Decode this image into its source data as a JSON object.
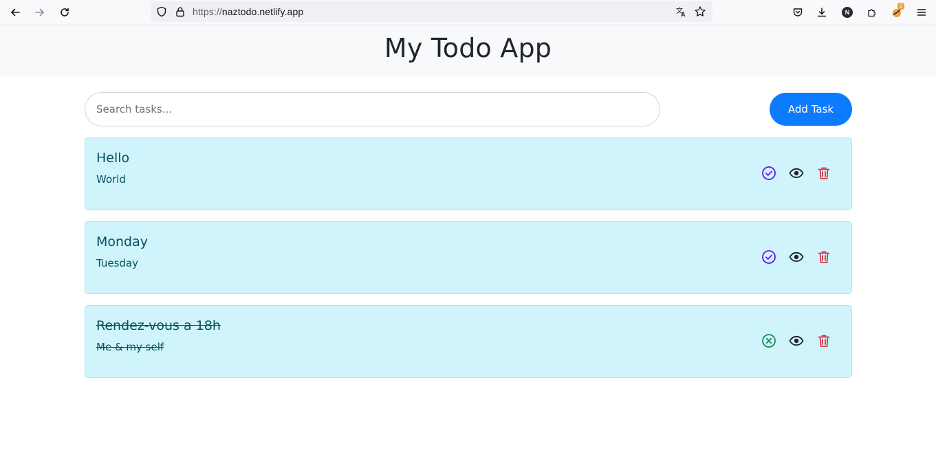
{
  "browser": {
    "url_scheme": "https://",
    "url_host": "naztodo.netlify.app",
    "profile_initial": "N",
    "notification_count": "2"
  },
  "app": {
    "title": "My Todo App"
  },
  "search": {
    "placeholder": "Search tasks...",
    "value": ""
  },
  "add_button_label": "Add Task",
  "colors": {
    "accent": "#0d7bfd",
    "task_bg": "#cff4fc",
    "task_text": "#055160",
    "complete_icon": "#6610f2",
    "uncomplete_icon": "#198754",
    "delete_icon": "#dc3545"
  },
  "tasks": [
    {
      "title": "Hello",
      "description": "World",
      "completed": false,
      "status_icon": "check-circle-icon"
    },
    {
      "title": "Monday",
      "description": "Tuesday",
      "completed": false,
      "status_icon": "check-circle-icon"
    },
    {
      "title": "Rendez-vous a 18h",
      "description": "Me & my self",
      "completed": true,
      "status_icon": "x-circle-icon"
    }
  ]
}
